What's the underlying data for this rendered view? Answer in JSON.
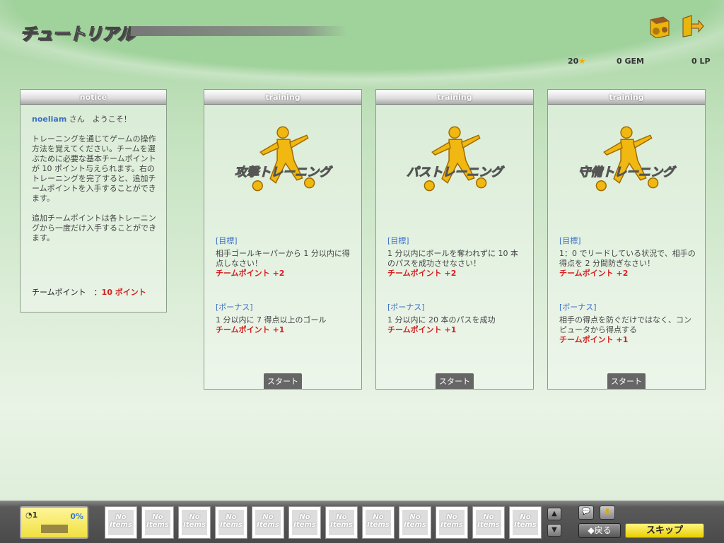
{
  "header": {
    "title": "チュートリアル",
    "stars": "20",
    "gem": "0 GEM",
    "lp": "0 LP"
  },
  "notice": {
    "header": "notice",
    "username": "noeliam",
    "greeting": "さん　ようこそ！",
    "para1": "トレーニングを通じてゲームの操作方法を覚えてください。チームを選ぶために必要な基本チームポイントが 10 ポイント与えられます。右のトレーニングを完了すると、追加チームポイントを入手することができます。",
    "para2": "追加チームポイントは各トレーニングから一度だけ入手することができます。",
    "points_label": "チームポイント　：",
    "points_value": "10 ポイント"
  },
  "trainings": [
    {
      "header": "training",
      "name": "攻撃トレーニング",
      "goal_label": "[目標]",
      "goal": "相手ゴールキーパーから 1 分以内に得点しなさい！",
      "goal_reward": "チームポイント +2",
      "bonus_label": "[ボーナス]",
      "bonus": "1 分以内に 7 得点以上のゴール",
      "bonus_reward": "チームポイント +1",
      "start": "スタート"
    },
    {
      "header": "training",
      "name": "パストレーニング",
      "goal_label": "[目標]",
      "goal": "1 分以内にボールを奪われずに 10 本のパスを成功させなさい！",
      "goal_reward": "チームポイント +2",
      "bonus_label": "[ボーナス]",
      "bonus": "1 分以内に 20 本のパスを成功",
      "bonus_reward": "チームポイント +1",
      "start": "スタート"
    },
    {
      "header": "training",
      "name": "守備トレーニング",
      "goal_label": "[目標]",
      "goal": "1：0 でリードしている状況で、相手の得点を 2 分間防ぎなさい！",
      "goal_reward": "チームポイント +2",
      "bonus_label": "[ボーナス]",
      "bonus": "相手の得点を防ぐだけではなく、コンピュータから得点する",
      "bonus_reward": "チームポイント +1",
      "start": "スタート"
    }
  ],
  "bottom": {
    "level": "1",
    "percent": "0%",
    "slot_text": "No Items",
    "back": "◆戻る",
    "skip": "スキップ"
  }
}
